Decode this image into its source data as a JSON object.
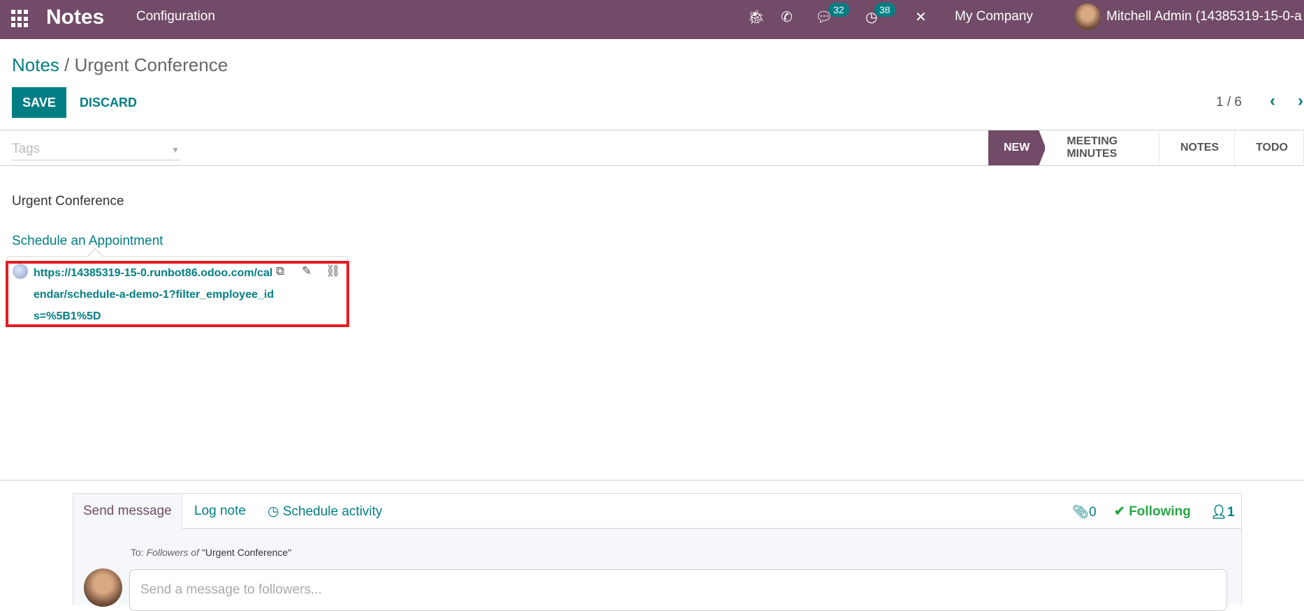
{
  "navbar": {
    "app_name": "Notes",
    "menu": [
      "Configuration"
    ],
    "messages_count": "32",
    "activities_count": "38",
    "company": "My Company",
    "user": "Mitchell Admin (14385319-15-0-a",
    "color": "#714B67"
  },
  "breadcrumb": {
    "root": "Notes",
    "separator": " / ",
    "current": "Urgent Conference"
  },
  "toolbar": {
    "save": "SAVE",
    "discard": "DISCARD",
    "pager": "1 / 6",
    "prev": "‹",
    "next": "›"
  },
  "tags": {
    "placeholder": "Tags"
  },
  "stages": [
    {
      "label": "NEW",
      "active": true
    },
    {
      "label": "MEETING MINUTES"
    },
    {
      "label": "NOTES"
    },
    {
      "label": "TODO"
    }
  ],
  "note": {
    "line1": "Urgent Conference",
    "line2": "Schedule an Appointment",
    "link": "https://14385319-15-0.runbot86.odoo.com/calendar/schedule-a-demo-1?filter_employee_ids=%5B1%5D"
  },
  "chatter": {
    "tabs": [
      "Send message",
      "Log note",
      "Schedule activity"
    ],
    "attachments": "0",
    "following": "Following",
    "followers": "1",
    "to_prefix": "To: ",
    "to_followers": "Followers of ",
    "to_record": "\"Urgent Conference\"",
    "input_placeholder": "Send a message to followers..."
  },
  "accent": "#017e84",
  "highlight": "#e41c23"
}
